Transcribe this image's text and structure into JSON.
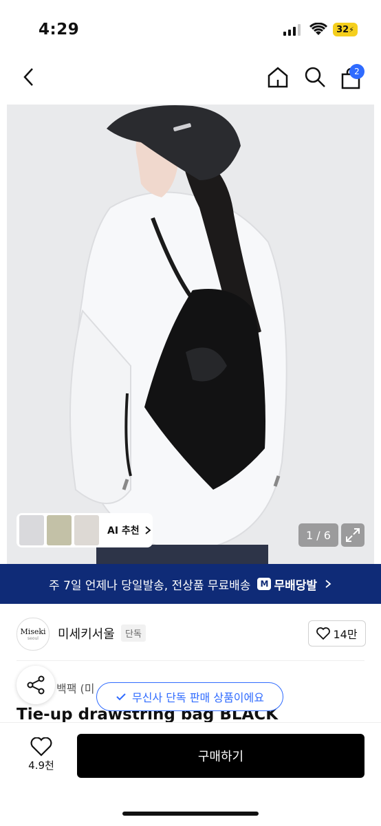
{
  "status": {
    "time": "4:29",
    "battery": "32"
  },
  "nav": {
    "cart_count": "2"
  },
  "hero": {
    "thumbs_label": "AI 추천",
    "counter": "1 / 6"
  },
  "banner": {
    "text": "주 7일 언제나 당일발송, 전상품 무료배송",
    "badge_letter": "M",
    "brand_text": "무배당발"
  },
  "brand": {
    "logo_text": "Miseki",
    "logo_sub": "seoul",
    "name": "미세키서울",
    "tag": "단독",
    "likes": "14만"
  },
  "product": {
    "category": "백팩 (미",
    "title": "Tie-up drawstring bag BLACK",
    "exclusive_pill": "무신사 단독 판매 상품이에요"
  },
  "bottom": {
    "heart_count": "4.9천",
    "buy_label": "구매하기"
  }
}
